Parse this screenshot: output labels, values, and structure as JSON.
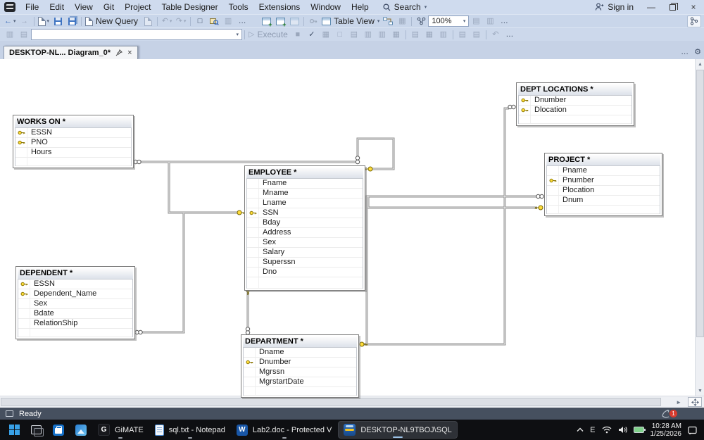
{
  "titlebar": {
    "menus": [
      "File",
      "Edit",
      "View",
      "Git",
      "Project",
      "Table Designer",
      "Tools",
      "Extensions",
      "Window",
      "Help"
    ],
    "search": "Search",
    "sign_in": "Sign in"
  },
  "toolbar": {
    "new_query": "New Query",
    "table_view": "Table View",
    "zoom": "100%",
    "execute": "Execute"
  },
  "icons": {
    "back": "←",
    "forward": "→",
    "caret": "▾",
    "undo": "↶",
    "redo": "↷",
    "more": "…",
    "run": "▷",
    "stop": "■",
    "check": "✓",
    "close": "×",
    "min": "—",
    "up": "▲",
    "down": "▼",
    "right": "►",
    "grid": "▦",
    "lines": "▤",
    "box": "□",
    "panel": "▥",
    "gear": "⚙",
    "chevron_up": "⌃"
  },
  "tabs": {
    "active": "DESKTOP-NL... Diagram_0*"
  },
  "diagram": {
    "tables": [
      {
        "name": "WORKS ON *",
        "columns": [
          {
            "name": "ESSN",
            "key": true
          },
          {
            "name": "PNO",
            "key": true
          },
          {
            "name": "Hours",
            "key": false
          }
        ]
      },
      {
        "name": "DEPT LOCATIONS *",
        "columns": [
          {
            "name": "Dnumber",
            "key": true
          },
          {
            "name": "Dlocation",
            "key": true
          }
        ]
      },
      {
        "name": "PROJECT *",
        "columns": [
          {
            "name": "Pname",
            "key": false
          },
          {
            "name": "Pnumber",
            "key": true
          },
          {
            "name": "Plocation",
            "key": false
          },
          {
            "name": "Dnum",
            "key": false
          }
        ]
      },
      {
        "name": "EMPLOYEE *",
        "columns": [
          {
            "name": "Fname",
            "key": false
          },
          {
            "name": "Mname",
            "key": false
          },
          {
            "name": "Lname",
            "key": false
          },
          {
            "name": "SSN",
            "key": true
          },
          {
            "name": "Bday",
            "key": false
          },
          {
            "name": "Address",
            "key": false
          },
          {
            "name": "Sex",
            "key": false
          },
          {
            "name": "Salary",
            "key": false
          },
          {
            "name": "Superssn",
            "key": false
          },
          {
            "name": "Dno",
            "key": false
          }
        ]
      },
      {
        "name": "DEPENDENT *",
        "columns": [
          {
            "name": "ESSN",
            "key": true
          },
          {
            "name": "Dependent_Name",
            "key": true
          },
          {
            "name": "Sex",
            "key": false
          },
          {
            "name": "Bdate",
            "key": false
          },
          {
            "name": "RelationShip",
            "key": false
          }
        ]
      },
      {
        "name": "DEPARTMENT *",
        "columns": [
          {
            "name": "Dname",
            "key": false
          },
          {
            "name": "Dnumber",
            "key": true
          },
          {
            "name": "Mgrssn",
            "key": false
          },
          {
            "name": "MgrstartDate",
            "key": false
          }
        ]
      }
    ],
    "relationships": [
      {
        "from": "WORKS ON.ESSN",
        "to": "EMPLOYEE.SSN"
      },
      {
        "from": "WORKS ON.PNO",
        "to": "PROJECT.Pnumber"
      },
      {
        "from": "EMPLOYEE.Superssn",
        "to": "EMPLOYEE.SSN"
      },
      {
        "from": "DEPENDENT.ESSN",
        "to": "EMPLOYEE.SSN"
      },
      {
        "from": "DEPARTMENT.Mgrssn",
        "to": "EMPLOYEE.SSN"
      },
      {
        "from": "DEPT LOCATIONS.Dnumber",
        "to": "DEPARTMENT.Dnumber"
      },
      {
        "from": "PROJECT.Dnum",
        "to": "DEPARTMENT.Dnumber"
      }
    ]
  },
  "status": {
    "text": "Ready",
    "badge": "1"
  },
  "taskbar": {
    "apps": [
      {
        "label": "GiMATE"
      },
      {
        "label": "sql.txt - Notepad"
      },
      {
        "label": "Lab2.doc - Protected V"
      },
      {
        "label": "DESKTOP-NL9TBOJ\\SQL"
      }
    ],
    "tray": {
      "lang": "E",
      "time": "10:28 AM",
      "date": "1/25/2026"
    }
  }
}
